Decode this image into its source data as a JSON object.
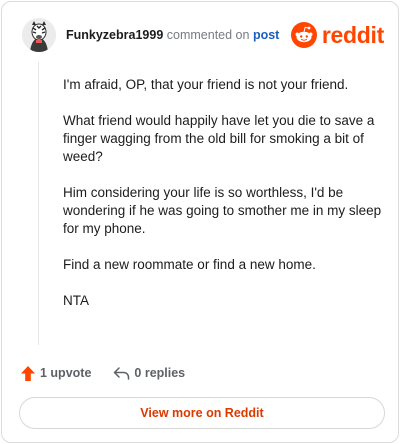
{
  "header": {
    "username": "Funkyzebra1999",
    "commented_text": "commented on",
    "post_link": "post",
    "brand": "reddit"
  },
  "comment": {
    "paragraphs": [
      "I'm afraid, OP, that your friend is not your friend.",
      "What friend would happily have let you die to save a finger wagging from the old bill for smoking a bit of weed?",
      "Him considering your life is so worthless, I'd be wondering if he was going to smother me in my sleep for my phone.",
      "Find a new roommate or find a new home.",
      "NTA"
    ]
  },
  "actions": {
    "upvotes": "1 upvote",
    "replies": "0 replies"
  },
  "footer": {
    "view_more": "View more on Reddit"
  },
  "colors": {
    "brand": "#ff4500",
    "upvote": "#ff4500",
    "link": "#1a5fbf",
    "cta": "#d93a00"
  },
  "icons": {
    "avatar": "zebra-avatar-icon",
    "brand": "reddit-snoo-icon",
    "upvote": "upvote-arrow-icon",
    "reply": "reply-arrow-icon"
  }
}
